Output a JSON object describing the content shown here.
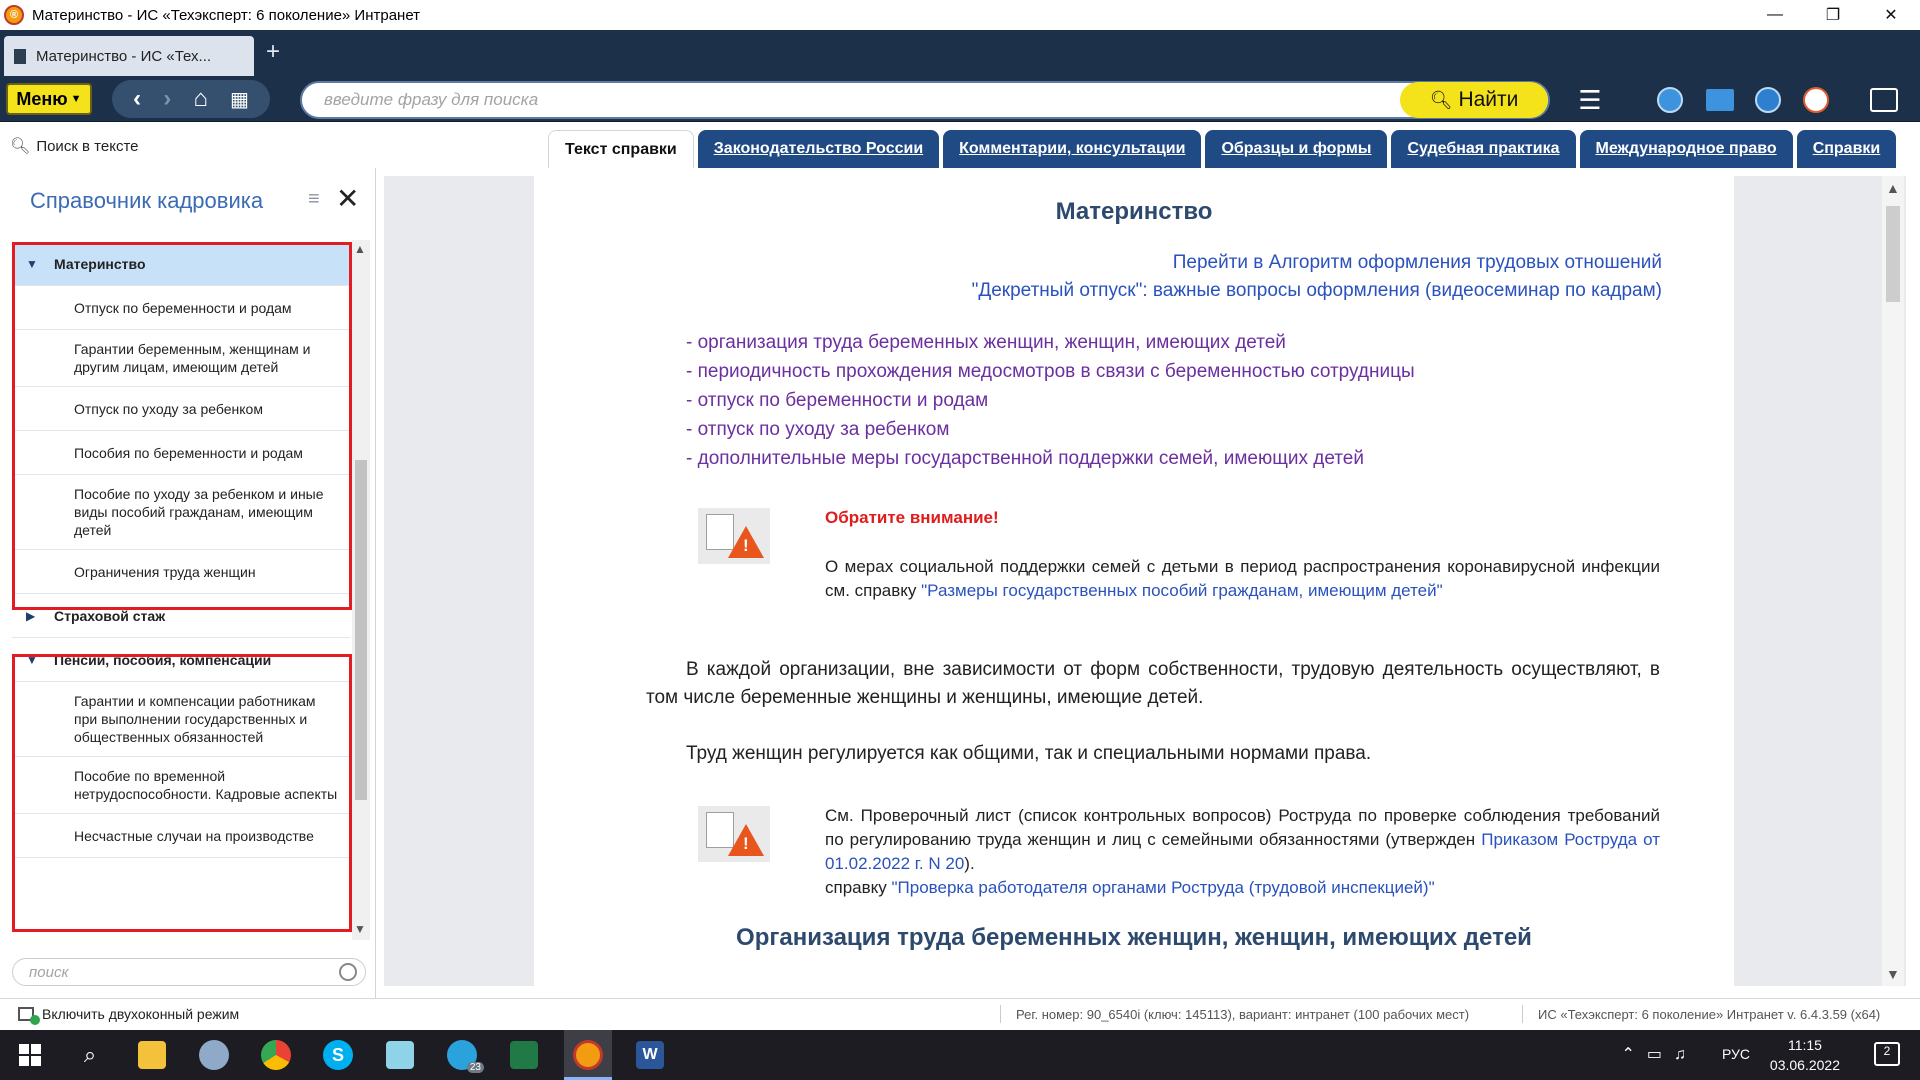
{
  "window": {
    "title": "Материнство - ИС «Техэксперт: 6 поколение» Интранет",
    "minimize": "—",
    "restore": "❐",
    "close": "✕"
  },
  "browser_tab": {
    "label": "Материнство - ИС «Тех...",
    "new_tab": "+"
  },
  "toolbar": {
    "menu_label": "Меню",
    "search_placeholder": "введите фразу для поиска",
    "find_label": "Найти",
    "icons": [
      "hamburger-icon",
      "user-icon",
      "folder-icon",
      "clock-icon",
      "stopwatch-icon",
      "messages-icon"
    ]
  },
  "left_search": {
    "label": "Поиск в тексте"
  },
  "sidebar": {
    "title": "Справочник кадровика",
    "search_placeholder": "поиск",
    "tree": {
      "group1": "Материнство",
      "g1_items": [
        "Отпуск по беременности и родам",
        "Гарантии беременным, женщинам и другим лицам, имеющим детей",
        "Отпуск по уходу за ребенком",
        "Пособия по беременности и родам",
        "Пособие по уходу за ребенком и иные виды пособий гражданам, имеющим детей",
        "Ограничения труда женщин"
      ],
      "group2": "Страховой стаж",
      "group3": "Пенсии, пособия, компенсации",
      "g3_items": [
        "Гарантии и компенсации работникам при выполнении государственных и общественных обязанностей",
        "Пособие по временной нетрудоспособности. Кадровые аспекты",
        "Несчастные случаи на производстве"
      ]
    }
  },
  "content_tabs": [
    "Текст справки",
    "Законодательство России",
    "Комментарии, консультации",
    "Образцы и формы",
    "Судебная практика",
    "Международное право",
    "Справки"
  ],
  "document": {
    "title": "Материнство",
    "link1": "Перейти в Алгоритм оформления трудовых отношений",
    "link2": "\"Декретный отпуск\": важные вопросы оформления (видеосеминар по кадрам)",
    "toc": [
      "организация труда беременных женщин, женщин, имеющих детей",
      "периодичность прохождения медосмотров в связи с беременностью сотрудницы",
      "отпуск по беременности и родам",
      "отпуск по уходу за ребенком",
      "дополнительные меры государственной поддержки семей, имеющих детей"
    ],
    "toc_dash": "- ",
    "attention": "Обратите внимание!",
    "note1_text": "О мерах социальной поддержки семей с детьми в период распространения коронавирусной инфекции см. справку ",
    "note1_link": "\"Размеры государственных пособий гражданам, имеющим детей\"",
    "para1": "В каждой организации, вне зависимости от форм собственности, трудовую деятельность осуществляют, в том числе беременные женщины и женщины, имеющие детей.",
    "para2": "Труд женщин регулируется как общими, так и специальными нормами права.",
    "note2_text": "См. Проверочный лист (список контрольных вопросов) Роструда по проверке соблюдения требований по регулированию труда женщин и лиц с семейными обязанностями (утвержден ",
    "note2_link1": "Приказом Роструда от 01.02.2022 г. N 20",
    "note2_end1": ").",
    "note2_text2": "справку ",
    "note2_link2": "\"Проверка работодателя органами Роструда (трудовой инспекцией)\"",
    "subheading": "Организация труда беременных женщин, женщин, имеющих детей"
  },
  "statusbar": {
    "two_window": "Включить двухоконный режим",
    "reg": "Рег. номер: 90_6540i (ключ: 145113), вариант: интранет (100 рабочих мест)",
    "version": "ИС «Техэксперт: 6 поколение» Интранет v. 6.4.3.59 (x64)"
  },
  "taskbar": {
    "lang": "РУС",
    "time": "11:15",
    "date": "03.06.2022",
    "notif_count": "2",
    "telegram_badge": "23"
  }
}
